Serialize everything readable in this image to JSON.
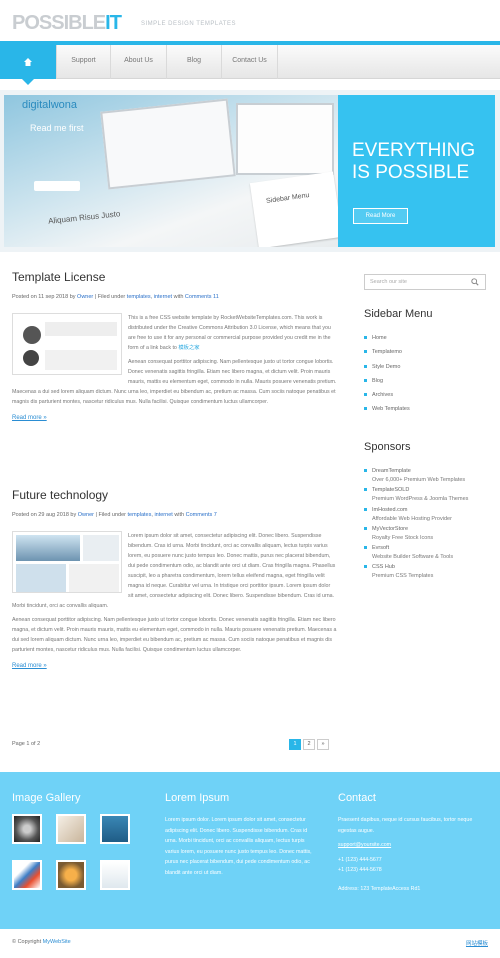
{
  "header": {
    "logo_main": "POSSIBLE",
    "logo_accent": "IT",
    "tagline": "SIMPLE DESIGN TEMPLATES"
  },
  "nav": {
    "items": [
      {
        "label": ""
      },
      {
        "label": "Support"
      },
      {
        "label": "About Us"
      },
      {
        "label": "Blog"
      },
      {
        "label": "Contact Us"
      }
    ]
  },
  "hero": {
    "title_line1": "EVERYTHING",
    "title_line2": "IS POSSIBLE",
    "button": "Read More",
    "img_brand": "digitalwona",
    "img_readme": "Read me first",
    "img_caption": "Aliquam Risus Justo",
    "img_menu": "Sidebar Menu"
  },
  "posts": [
    {
      "title": "Template License",
      "meta_prefix": "Posted on 11 sep 2018 by",
      "author": "Owner",
      "meta_mid": "| Filed under",
      "cat1": "templates",
      "cat2": "internet",
      "meta_with": "with",
      "comments": "Comments 11",
      "body1": "This is a free CSS website template by RocketWebsiteTemplates.com. This work is distributed under the Creative Commons Attribution 3.0 License, which means that you are free to use it for any personal or commercial purpose provided you credit me in the form of a link back to",
      "body1_link": "模板之家",
      "body2": "Aenean consequat porttitor adipiscing. Nam pellentesque justo ut tortor congue lobortis. Donec venenatis sagittis fringilla. Etiam nec libero magna, et dictum velit. Proin mauris mauris, mattis eu elementum eget, commodo in nulla. Mauris posuere venenatis pretium. Maecenas a dui sed lorem aliquam dictum. Nunc urna leo, imperdiet eu bibendum ac, pretium ac massa. Cum sociis natoque penatibus et magnis dis parturient montes, nascetur ridiculus mus. Nulla facilisi. Quisque condimentum luctus ullamcorper.",
      "readmore": "Read more »"
    },
    {
      "title": "Future technology",
      "meta_prefix": "Posted on 29 aug 2018 by",
      "author": "Owner",
      "meta_mid": "| Filed under",
      "cat1": "templates",
      "cat2": "internet",
      "meta_with": "with",
      "comments": "Comments 7",
      "body1": "Lorem ipsum dolor sit amet, consectetur adipiscing elit. Donec libero. Suspendisse bibendum. Cras id urna. Morbi tincidunt, orci ac convallis aliquam, lectus turpis varius lorem, eu posuere nunc justo tempus leo. Donec mattis, purus nec placerat bibendum, dui pede condimentum odio, ac blandit ante orci ut diam. Cras fringilla magna. Phasellus suscipit, leo a pharetra condimentum, lorem tellus eleifend magna, eget fringilla velit magna id neque. Curabitur vel urna. In tristique orci porttitor ipsum. Lorem ipsum dolor sit amet, consectetur adipiscing elit. Donec libero. Suspendisse bibendum. Cras id urna. Morbi tincidunt, orci ac convallis aliquam.",
      "body2": "Aenean consequat porttitor adipiscing. Nam pellentesque justo ut tortor congue lobortis. Donec venenatis sagittis fringilla. Etiam nec libero magna, et dictum velit. Proin mauris mauris, mattis eu elementum eget, commodo in nulla. Mauris posuere venenatis pretium. Maecenas a dui sed lorem aliquam dictum. Nunc urna leo, imperdiet eu bibendum ac, pretium ac massa. Cum sociis natoque penatibus et magnis dis parturient montes, nascetur ridiculus mus. Nulla facilisi. Quisque condimentum luctus ullamcorper.",
      "readmore": "Read more »"
    }
  ],
  "pagination": {
    "text": "Page 1 of 2",
    "pages": [
      "1",
      "2",
      "»"
    ]
  },
  "sidebar": {
    "search_placeholder": "Search our site",
    "menu_title": "Sidebar Menu",
    "menu": [
      "Home",
      "Templatemo",
      "Style Demo",
      "Blog",
      "Archives",
      "Web Templates"
    ],
    "sponsors_title": "Sponsors",
    "sponsors": [
      {
        "name": "DreamTemplate",
        "desc": "Over 6,000+ Premium Web Templates"
      },
      {
        "name": "TemplateSOLD",
        "desc": "Premium WordPress & Joomla Themes"
      },
      {
        "name": "ImHosted.com",
        "desc": "Affordable Web Hosting Provider"
      },
      {
        "name": "MyVectorStore",
        "desc": "Royalty Free Stock Icons"
      },
      {
        "name": "Evrsoft",
        "desc": "Website Builder Software & Tools"
      },
      {
        "name": "CSS Hub",
        "desc": "Premium CSS Templates"
      }
    ]
  },
  "footer": {
    "gallery_title": "Image Gallery",
    "lorem_title": "Lorem Ipsum",
    "lorem_text": "Lorem ipsum dolor. Lorem ipsum dolor sit amet, consectetur adipiscing elit. Donec libero. Suspendisse bibendum. Cras id urna. Morbi tincidunt, orci ac convallis aliquam, lectus turpis varius lorem, eu posuere nunc justo tempus leo. Donec mattis, purus nec placerat bibendum, dui pede condimentum odio, ac blandit ante orci ut diam.",
    "contact_title": "Contact",
    "contact_text": "Praesent dapibus, neque id cursus faucibus, tortor neque egestas augue.",
    "email": "support@yoursite.com",
    "phone1": "+1 (123) 444-5677",
    "phone2": "+1 (123) 444-5678",
    "address": "Address: 123 TemplateAccess Rd1"
  },
  "bottom": {
    "copyright": "© Copyright",
    "owner": "MyWebSite",
    "right_link": "网站模板"
  },
  "colors": {
    "accent": "#29b6e8",
    "footer": "#6fd2f7"
  }
}
